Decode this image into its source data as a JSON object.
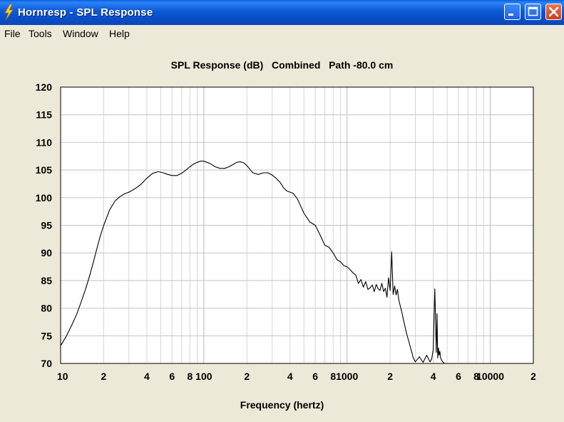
{
  "window": {
    "title": "Hornresp - SPL Response",
    "controls": [
      "minimize",
      "maximize",
      "close"
    ]
  },
  "menu": [
    "File",
    "Tools",
    "Window",
    "Help"
  ],
  "plot": {
    "title": "SPL Response (dB)   Combined   Path -80.0 cm"
  },
  "chart_data": {
    "type": "line",
    "title": "SPL Response (dB)   Combined   Path -80.0 cm",
    "xlabel": "Frequency (hertz)",
    "ylabel": "",
    "xscale": "log",
    "xlim": [
      10,
      20000
    ],
    "ylim": [
      70,
      120
    ],
    "grid": true,
    "yticks": [
      "120",
      "115",
      "110",
      "105",
      "100",
      "95",
      "90",
      "85",
      "80",
      "75",
      "70"
    ],
    "xticks": [
      {
        "value": 10,
        "label": "10"
      },
      {
        "value": 20,
        "label": "2"
      },
      {
        "value": 40,
        "label": "4"
      },
      {
        "value": 60,
        "label": "6"
      },
      {
        "value": 80,
        "label": "8"
      },
      {
        "value": 100,
        "label": "100"
      },
      {
        "value": 200,
        "label": "2"
      },
      {
        "value": 400,
        "label": "4"
      },
      {
        "value": 600,
        "label": "6"
      },
      {
        "value": 800,
        "label": "8"
      },
      {
        "value": 1000,
        "label": "1000"
      },
      {
        "value": 2000,
        "label": "2"
      },
      {
        "value": 4000,
        "label": "4"
      },
      {
        "value": 6000,
        "label": "6"
      },
      {
        "value": 8000,
        "label": "8"
      },
      {
        "value": 10000,
        "label": "10000"
      },
      {
        "value": 20000,
        "label": "2"
      }
    ],
    "series": [
      {
        "color": "#000000",
        "x": [
          10,
          11,
          12,
          13,
          14,
          15,
          16,
          17,
          18,
          19,
          20,
          22,
          24,
          26,
          28,
          30,
          33,
          36,
          40,
          44,
          48,
          52,
          56,
          60,
          65,
          70,
          75,
          80,
          85,
          90,
          95,
          100,
          110,
          120,
          130,
          140,
          150,
          160,
          170,
          180,
          190,
          200,
          210,
          220,
          240,
          260,
          280,
          300,
          320,
          340,
          360,
          380,
          400,
          420,
          450,
          480,
          500,
          550,
          600,
          650,
          700,
          750,
          800,
          850,
          900,
          950,
          1000,
          1050,
          1100,
          1150,
          1200,
          1250,
          1300,
          1350,
          1400,
          1450,
          1500,
          1550,
          1600,
          1650,
          1700,
          1750,
          1800,
          1850,
          1900,
          1950,
          2000,
          2050,
          2100,
          2150,
          2200,
          2250,
          2300,
          2350,
          2400,
          2500,
          2600,
          2700,
          2800,
          2900,
          3000,
          3200,
          3400,
          3600,
          3800,
          3900,
          4000,
          4100,
          4200,
          4250,
          4300,
          4350,
          4400,
          4450,
          4500,
          4600,
          4700,
          4800,
          4900,
          5000
        ],
        "y": [
          73.2,
          75.0,
          77.0,
          79.0,
          81.3,
          83.6,
          86.0,
          88.5,
          91.0,
          93.2,
          95.0,
          97.8,
          99.4,
          100.2,
          100.7,
          101.0,
          101.6,
          102.3,
          103.5,
          104.4,
          104.7,
          104.5,
          104.2,
          104.0,
          104.0,
          104.4,
          105.0,
          105.6,
          106.1,
          106.4,
          106.6,
          106.6,
          106.2,
          105.6,
          105.3,
          105.3,
          105.6,
          106.0,
          106.4,
          106.5,
          106.3,
          105.8,
          105.1,
          104.5,
          104.2,
          104.5,
          104.5,
          104.1,
          103.5,
          102.8,
          101.8,
          101.2,
          101.0,
          100.8,
          99.8,
          98.2,
          97.2,
          95.6,
          95.0,
          93.2,
          91.4,
          91.0,
          90.0,
          88.8,
          88.4,
          87.7,
          87.5,
          87.0,
          86.4,
          86.0,
          84.5,
          85.2,
          83.8,
          84.8,
          83.4,
          83.7,
          84.2,
          83.0,
          84.3,
          83.5,
          83.2,
          84.5,
          83.0,
          83.6,
          82.0,
          85.5,
          83.2,
          90.2,
          82.5,
          84.0,
          82.4,
          83.4,
          81.5,
          80.5,
          79.5,
          77.5,
          75.5,
          74.0,
          72.5,
          71.0,
          70.3,
          71.2,
          70.2,
          71.5,
          70.3,
          70.8,
          72.5,
          83.5,
          72.0,
          79.0,
          71.0,
          72.8,
          71.5,
          72.2,
          71.0,
          70.5,
          70.2,
          70.0,
          70.0,
          70.0
        ]
      }
    ]
  }
}
